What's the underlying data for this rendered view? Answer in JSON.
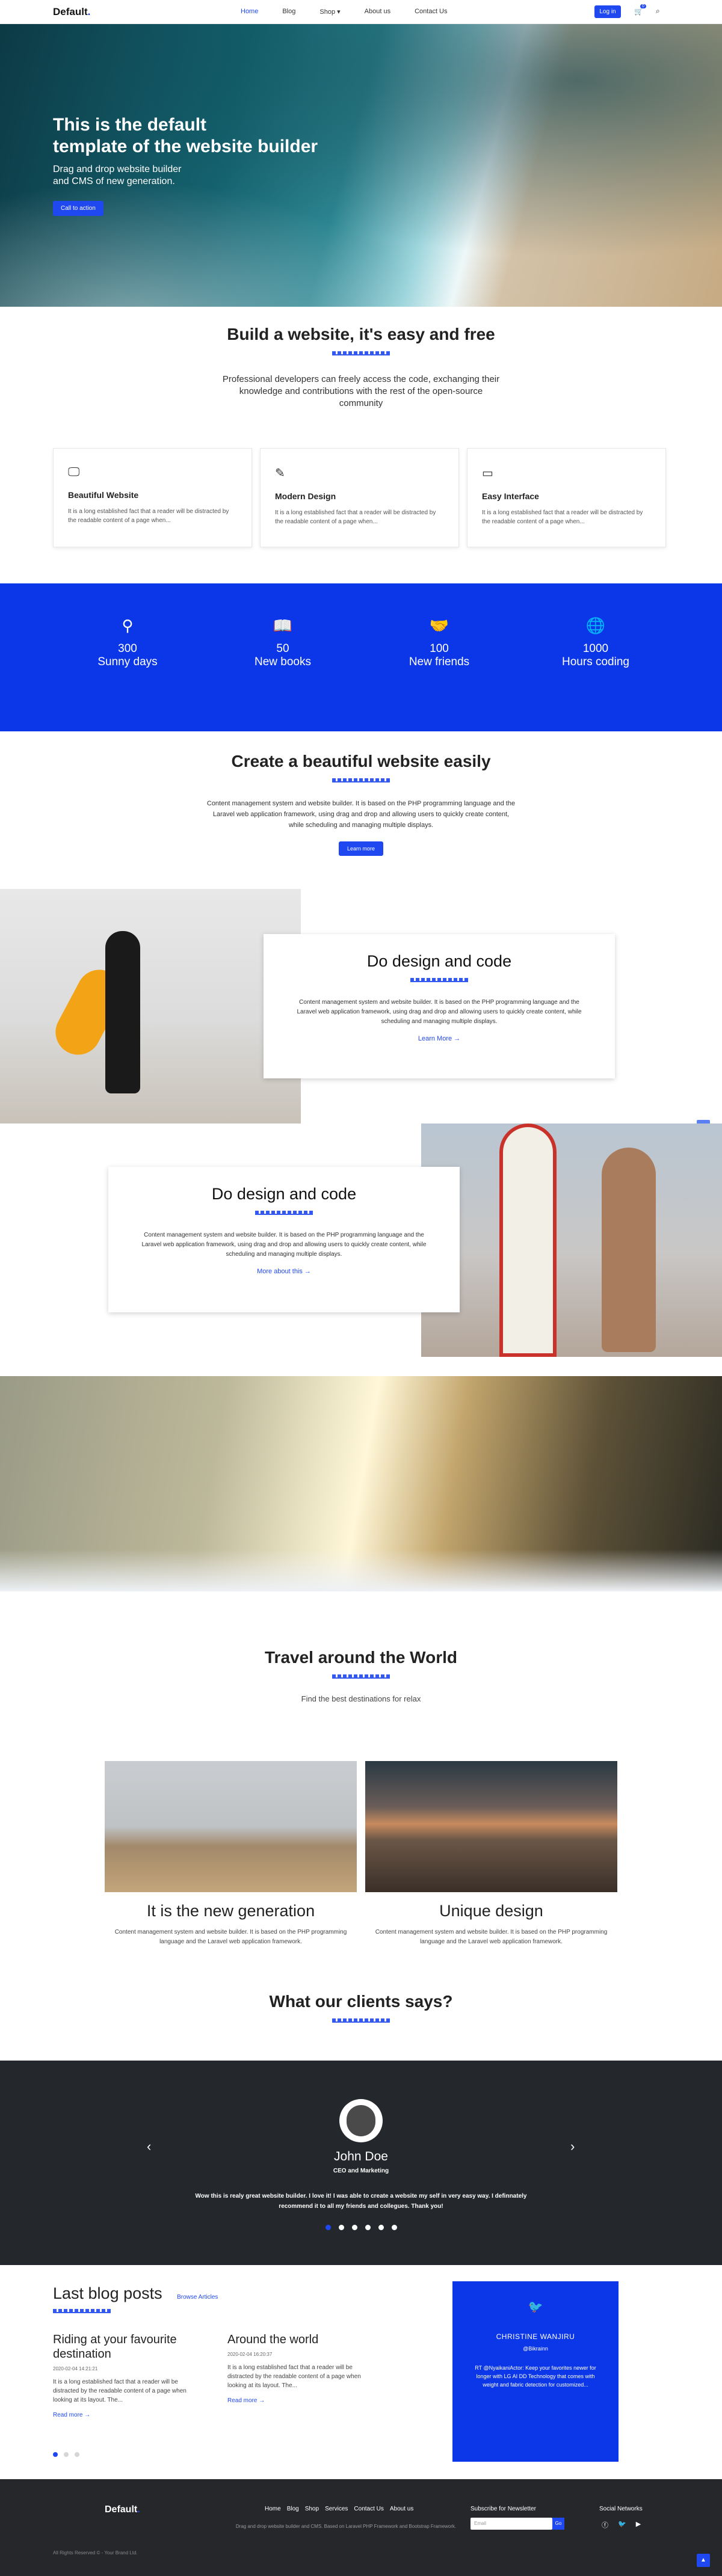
{
  "brand": "Default",
  "nav": {
    "items": [
      "Home",
      "Blog",
      "Shop",
      "About us",
      "Contact Us"
    ],
    "shop_caret": "▾",
    "login": "Log in",
    "cart_count": "0"
  },
  "hero": {
    "title_line1": "This is the default",
    "title_line2": "template of the website builder",
    "sub_line1": "Drag and drop website builder",
    "sub_line2": "and CMS of new generation.",
    "cta": "Call to action"
  },
  "build": {
    "title": "Build a website, it's easy and free",
    "text": "Professional developers can freely access the code, exchanging their knowledge and contributions with the rest of the open-source community"
  },
  "features": [
    {
      "icon": "monitor-icon",
      "title": "Beautiful Website",
      "text": "It is a long established fact that a reader will be distracted by the readable content of a page when..."
    },
    {
      "icon": "pen-icon",
      "title": "Modern Design",
      "text": "It is a long established fact that a reader will be distracted by the readable content of a page when..."
    },
    {
      "icon": "window-icon",
      "title": "Easy Interface",
      "text": "It is a long established fact that a reader will be distracted by the readable content of a page when..."
    }
  ],
  "stats": [
    {
      "icon": "bicycle-icon",
      "num": "300",
      "label": "Sunny days"
    },
    {
      "icon": "book-icon",
      "num": "50",
      "label": "New books"
    },
    {
      "icon": "handshake-icon",
      "num": "100",
      "label": "New friends"
    },
    {
      "icon": "globe-icon",
      "num": "1000",
      "label": "Hours coding"
    }
  ],
  "create": {
    "title": "Create a beautiful website easily",
    "text": "Content management system and website builder. It is based on the PHP programming language and the Laravel web application framework, using drag and drop and allowing users to quickly create content, while scheduling and managing multiple displays.",
    "button": "Learn more"
  },
  "design1": {
    "title": "Do design and code",
    "text": "Content management system and website builder. It is based on the PHP programming language and the Laravel web application framework, using drag and drop and allowing users to quickly create content, while scheduling and managing multiple displays.",
    "link": "Learn More →"
  },
  "design2": {
    "title": "Do design and code",
    "text": "Content management system and website builder. It is based on the PHP programming language and the Laravel web application framework, using drag and drop and allowing users to quickly create content, while scheduling and managing multiple displays.",
    "link": "More about this →"
  },
  "travel": {
    "title": "Travel around the World",
    "sub": "Find the best destinations for relax"
  },
  "trips": [
    {
      "title": "It is the new generation",
      "text": "Content management system and website builder. It is based on the PHP programming language and the Laravel web application framework."
    },
    {
      "title": "Unique design",
      "text": "Content management system and website builder. It is based on the PHP programming language and the Laravel web application framework."
    }
  ],
  "clients": {
    "title": "What our clients says?"
  },
  "testimonial": {
    "name": "John Doe",
    "role": "CEO and Marketing",
    "quote": "Wow this is realy great website builder. I love it! I was able to create a website my self in very easy way. I definnately recommend it to all my friends and collegues. Thank you!",
    "prev": "‹",
    "next": "›"
  },
  "blog": {
    "title": "Last blog posts",
    "browse": "Browse Articles",
    "posts": [
      {
        "title": "Riding at your favourite destination",
        "date": "2020-02-04 14:21:21",
        "text": "It is a long established fact that a reader will be distracted by the readable content of a page when looking at its layout. The...",
        "more": "Read more →"
      },
      {
        "title": "Around the world",
        "date": "2020-02-04 16:20:37",
        "text": "It is a long established fact that a reader will be distracted by the readable content of a page when looking at its layout. The...",
        "more": "Read more →"
      }
    ]
  },
  "tweet": {
    "name": "CHRISTINE WANJIRU",
    "handle": "@Bikrainn",
    "text": "RT @NyaikaniActor: Keep your favorites newer for longer with LG AI DD Technology that comes with weight and fabric detection for customized..."
  },
  "footer": {
    "brand": "Default",
    "menu": [
      "Home",
      "Blog",
      "Shop",
      "Services",
      "Contact Us",
      "About us"
    ],
    "desc": "Drag and drop website builder and CMS. Based on Laravel PHP Framework and Bootstrap Framework.",
    "newsletter": "Subscribe for Newsletter",
    "email_placeholder": "Email",
    "go": "Go",
    "social": "Social Networks",
    "copy": "All Rights Reserved © - Your Brand Ltd."
  }
}
